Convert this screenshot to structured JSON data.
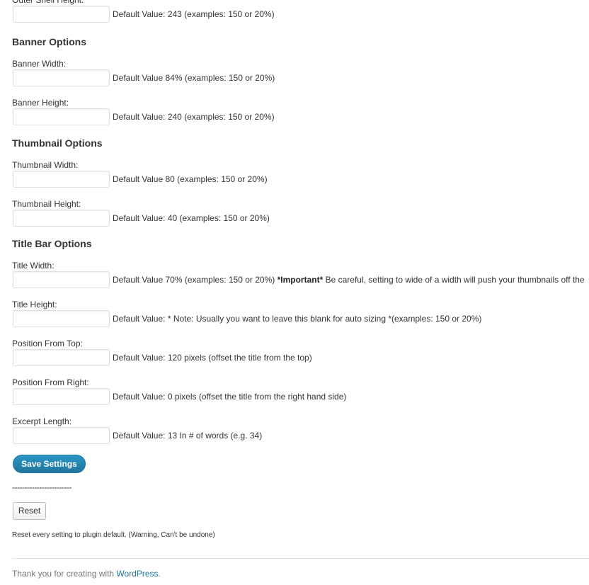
{
  "sections": {
    "banner": "Banner Options",
    "thumbnail": "Thumbnail Options",
    "title_bar": "Title Bar Options"
  },
  "fields": {
    "outer_shell_height": {
      "label": "Outer Shell Height:",
      "value": "",
      "hint": "Default Value: 243 (examples: 150 or 20%)"
    },
    "banner_width": {
      "label": "Banner Width:",
      "value": "",
      "hint": "Default Value 84% (examples: 150 or 20%)"
    },
    "banner_height": {
      "label": "Banner Height:",
      "value": "",
      "hint": "Default Value: 240 (examples: 150 or 20%)"
    },
    "thumbnail_width": {
      "label": "Thumbnail Width:",
      "value": "",
      "hint": "Default Value 80 (examples: 150 or 20%)"
    },
    "thumbnail_height": {
      "label": "Thumbnail Height:",
      "value": "",
      "hint": "Default Value: 40 (examples: 150 or 20%)"
    },
    "title_width": {
      "label": "Title Width:",
      "value": "",
      "hint": "Default Value 70% (examples: 150 or 20%)",
      "important_label": "*Important*",
      "important_text": "Be careful, setting to wide of a width will push your thumbnails off the"
    },
    "title_height": {
      "label": "Title Height:",
      "value": "",
      "hint": "Default Value: * Note: Usually you want to leave this blank for auto sizing *(examples: 150 or 20%)"
    },
    "position_from_top": {
      "label": "Position From Top:",
      "value": "",
      "hint": "Default Value: 120 pixels (offset the title from the top)"
    },
    "position_from_right": {
      "label": "Position From Right:",
      "value": "",
      "hint": "Default Value: 0 pixels (offset the title from the right hand side)"
    },
    "excerpt_length": {
      "label": "Excerpt Length:",
      "value": "",
      "hint": "Default Value: 13 In # of words (e.g. 34)"
    }
  },
  "actions": {
    "save_label": "Save Settings",
    "divider": "------------------------",
    "reset_label": "Reset",
    "reset_warning": "Reset every setting to plugin default. (Warning, Can't be undone)"
  },
  "footer": {
    "text": "Thank you for creating with ",
    "link": "WordPress",
    "suffix": "."
  },
  "colors": {
    "primary_button": "#21759b",
    "link": "#21759b",
    "text": "#333333",
    "footer_text": "#777777",
    "input_border": "#dfdfdf"
  }
}
